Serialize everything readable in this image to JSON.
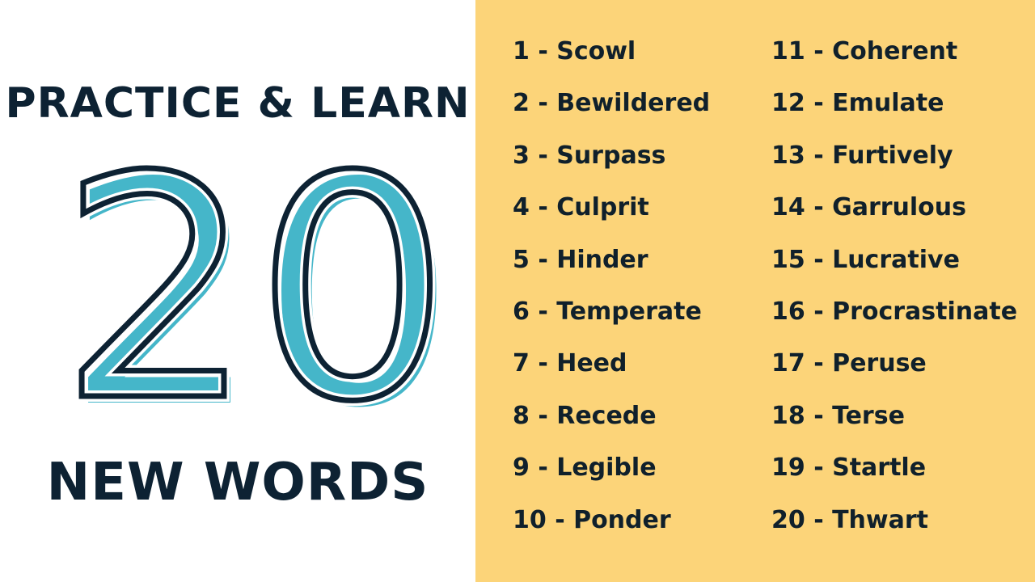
{
  "headline_top": "PRACTICE & LEARN",
  "big_number": "20",
  "headline_bottom": "NEW WORDS",
  "colors": {
    "accent": "#45b6c9",
    "outline": "#0d2233",
    "panel": "#fcd479"
  },
  "words_col1": [
    "1 - Scowl",
    "2 - Bewildered",
    "3 - Surpass",
    "4 - Culprit",
    "5 - Hinder",
    "6 - Temperate",
    "7 - Heed",
    "8 - Recede",
    "9 - Legible",
    "10 - Ponder"
  ],
  "words_col2": [
    "11 - Coherent",
    "12 - Emulate",
    "13 - Furtively",
    "14 - Garrulous",
    "15 - Lucrative",
    "16 - Procrastinate",
    "17 - Peruse",
    "18 - Terse",
    "19 - Startle",
    "20 - Thwart"
  ]
}
